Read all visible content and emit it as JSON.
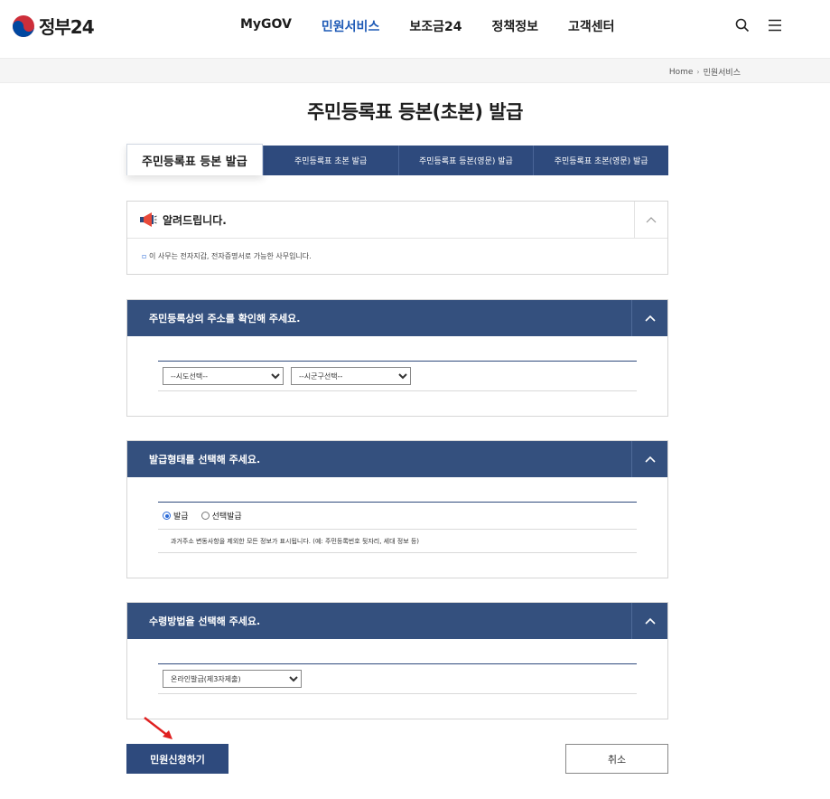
{
  "header": {
    "logo_text": "정부24",
    "nav": [
      "MyGOV",
      "민원서비스",
      "보조금24",
      "정책정보",
      "고객센터"
    ],
    "active_nav": 1
  },
  "breadcrumb": {
    "home": "Home",
    "current": "민원서비스"
  },
  "page_title": "주민등록표 등본(초본) 발급",
  "tabs": [
    "주민등록표 등본 발급",
    "주민등록표 초본 발급",
    "주민등록표 등본(영문) 발급",
    "주민등록표 초본(영문) 발급"
  ],
  "notice": {
    "title": "알려드립니다.",
    "text": "이 사무는 전자지갑, 전자증명서로 가능한 사무입니다."
  },
  "address_section": {
    "title": "주민등록상의 주소를 확인해 주세요.",
    "sido_value": "--시도선택--",
    "sigungu_value": "--시군구선택--"
  },
  "issue_type_section": {
    "title": "발급형태를 선택해 주세요.",
    "option_all": "발급",
    "option_select": "선택발급",
    "description": "과거주소 변동사항을 제외한 모든 정보가 표시됩니다. (예: 주민등록번호 뒷자리, 세대 정보 등)"
  },
  "receive_section": {
    "title": "수령방법을 선택해 주세요.",
    "method_value": "온라인발급(제3자제출)"
  },
  "buttons": {
    "apply": "민원신청하기",
    "cancel": "취소"
  },
  "colors": {
    "navy": "#2e4a7d",
    "active_nav": "#1e5ab6",
    "arrow": "#e02020"
  }
}
